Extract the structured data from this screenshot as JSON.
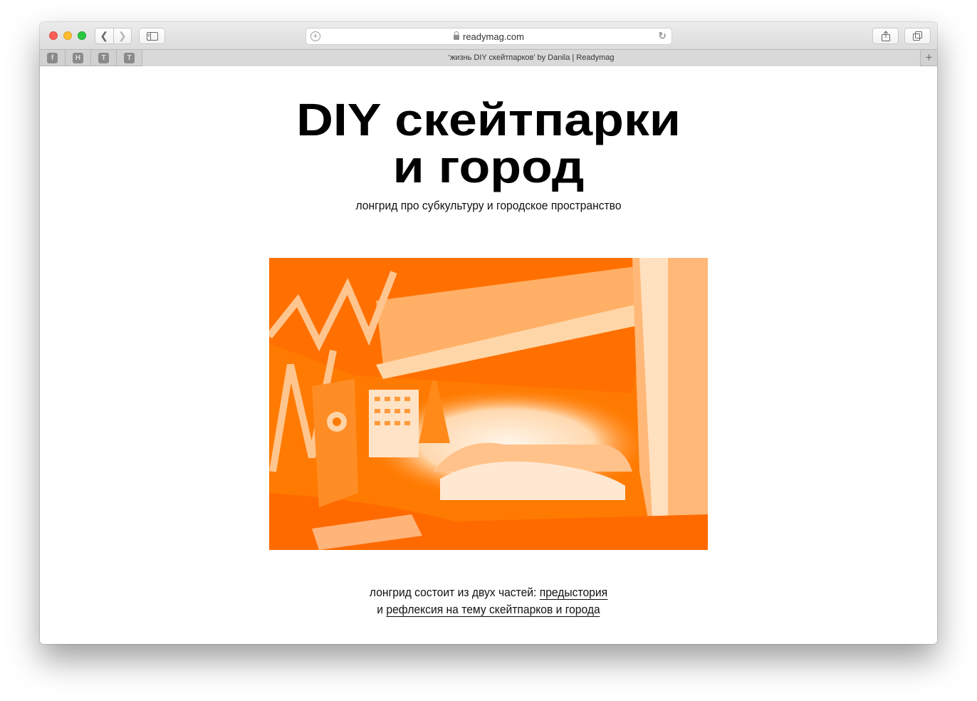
{
  "browser": {
    "url": "readymag.com",
    "tab_title": "‘жизнь DIY скейтпарков’ by Danila | Readymag",
    "favorites": [
      "f",
      "H",
      "T",
      "T"
    ],
    "icons": {
      "back": "chevron-left-icon",
      "forward": "chevron-right-icon",
      "sidebar": "sidebar-icon",
      "share": "share-icon",
      "tabs": "tabs-overview-icon",
      "reload": "reload-icon",
      "new_tab": "plus-icon"
    }
  },
  "page": {
    "title_line1": "DIY скейтпарки",
    "title_line2": "и город",
    "subtitle": "лонгрид про субкультуру и городское пространство",
    "caption": {
      "text1": "лонгрид состоит из двух частей: ",
      "link1": "предыстория",
      "text2": "и ",
      "link2": "рефлексия на тему скейтпарков и города"
    },
    "accent_color": "#ff7a00"
  }
}
